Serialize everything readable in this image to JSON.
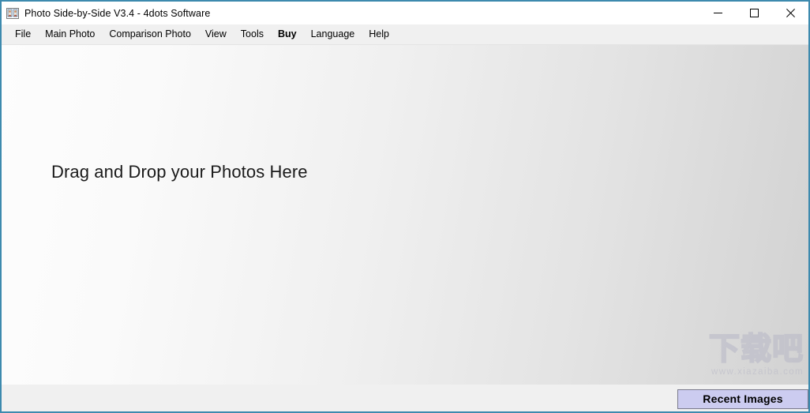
{
  "window": {
    "title": "Photo Side-by-Side V3.4 - 4dots Software",
    "icon": "photo-pair-icon",
    "border_color": "#3d8aae",
    "controls": {
      "minimize": "minimize-icon",
      "maximize": "maximize-icon",
      "close": "close-icon"
    }
  },
  "menubar": {
    "items": [
      {
        "label": "File",
        "bold": false
      },
      {
        "label": "Main Photo",
        "bold": false
      },
      {
        "label": "Comparison Photo",
        "bold": false
      },
      {
        "label": "View",
        "bold": false
      },
      {
        "label": "Tools",
        "bold": false
      },
      {
        "label": "Buy",
        "bold": true
      },
      {
        "label": "Language",
        "bold": false
      },
      {
        "label": "Help",
        "bold": false
      }
    ]
  },
  "main": {
    "drop_text": "Drag and Drop your Photos Here",
    "background_start": "#fdfdfd",
    "background_end": "#d2d2d2"
  },
  "watermark": {
    "text_cn": "下载吧",
    "url": "www.xiazaiba.com",
    "color": "#b7b7c6"
  },
  "bottombar": {
    "recent_images_label": "Recent Images",
    "recent_images_bg": "#ccccf0",
    "recent_images_border": "#7a7a8c"
  }
}
